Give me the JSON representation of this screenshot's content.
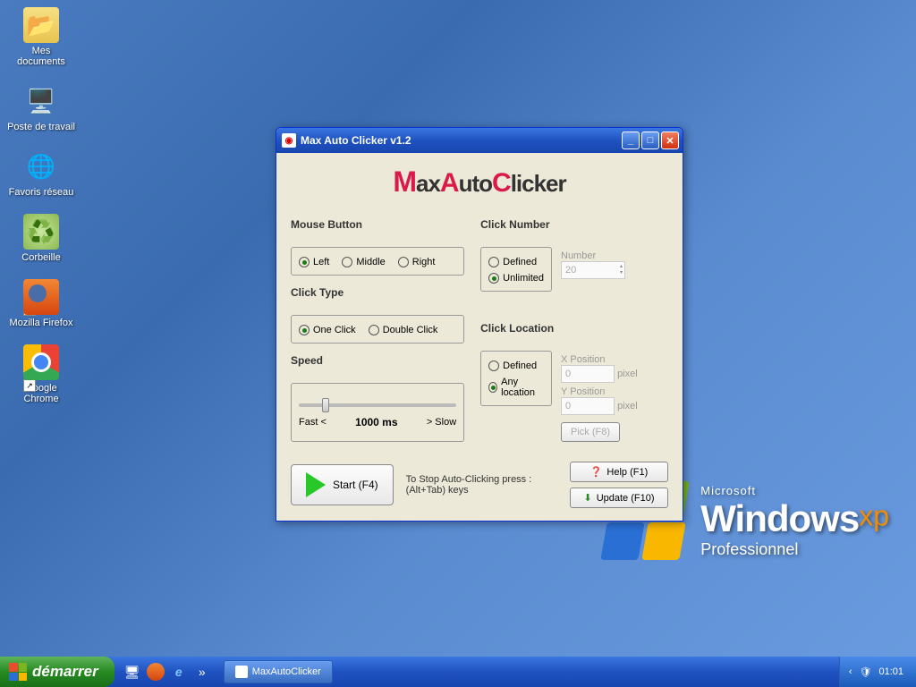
{
  "desktop": {
    "icons": [
      {
        "label": "Mes documents"
      },
      {
        "label": "Poste de travail"
      },
      {
        "label": "Favoris réseau"
      },
      {
        "label": "Corbeille"
      },
      {
        "label": "Mozilla Firefox"
      },
      {
        "label": "Google Chrome"
      }
    ],
    "branding": {
      "company": "Microsoft",
      "product": "Windows",
      "suffix": "xp",
      "edition": "Professionnel"
    }
  },
  "window": {
    "title": "Max Auto Clicker v1.2",
    "logo": {
      "m": "M",
      "ax": "ax",
      "a": "A",
      "uto": "uto",
      "c": "C",
      "licker": "licker"
    },
    "mouseButton": {
      "heading": "Mouse Button",
      "left": "Left",
      "middle": "Middle",
      "right": "Right",
      "selected": "left"
    },
    "clickType": {
      "heading": "Click Type",
      "one": "One Click",
      "double": "Double Click",
      "selected": "one"
    },
    "speed": {
      "heading": "Speed",
      "fast": "Fast <",
      "value": "1000 ms",
      "slow": "> Slow"
    },
    "clickNumber": {
      "heading": "Click Number",
      "defined": "Defined",
      "unlimited": "Unlimited",
      "selected": "unlimited",
      "numberLabel": "Number",
      "numberValue": "20"
    },
    "clickLocation": {
      "heading": "Click Location",
      "defined": "Defined",
      "any": "Any location",
      "selected": "any",
      "xLabel": "X Position",
      "xValue": "0",
      "yLabel": "Y Position",
      "yValue": "0",
      "pixel": "pixel",
      "pickLabel": "Pick (F8)"
    },
    "start": "Start (F4)",
    "stopHint1": "To Stop Auto-Clicking press :",
    "stopHint2": "(Alt+Tab) keys",
    "help": "Help (F1)",
    "update": "Update (F10)"
  },
  "taskbar": {
    "start": "démarrer",
    "task": "MaxAutoClicker",
    "clock": "01:01"
  }
}
